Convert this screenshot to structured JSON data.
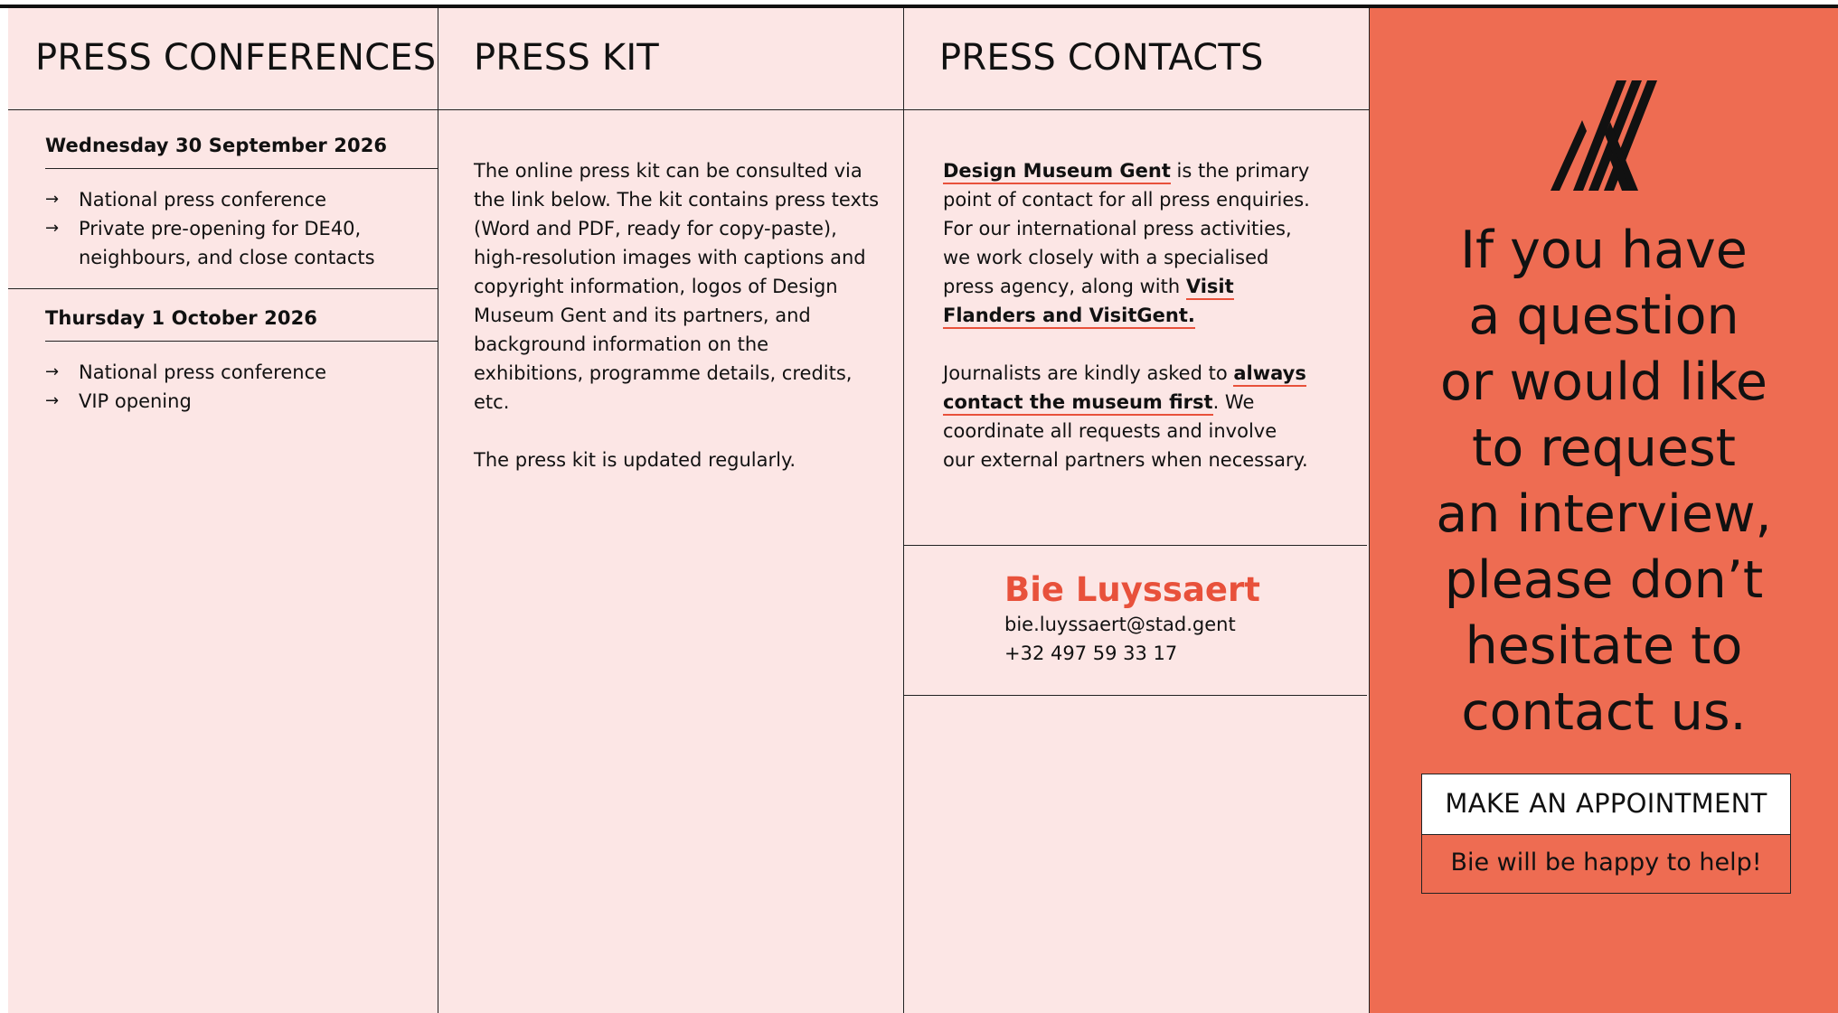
{
  "press_conferences": {
    "title": "PRESS CONFERENCES",
    "days": [
      {
        "date": "Wednesday 30 September 2026",
        "events": [
          "National press conference",
          "Private pre-opening for DE40, neighbours, and close contacts"
        ]
      },
      {
        "date": "Thursday 1 October 2026",
        "events": [
          "National press conference",
          "VIP opening"
        ]
      }
    ]
  },
  "press_kit": {
    "title": "PRESS KIT",
    "paragraph1": "The online press kit can be consulted via the link below. The kit contains press texts (Word and PDF, ready for copy-paste), high-resolution images with captions and copyright information, logos of Design Museum Gent and its partners, and background information on the exhibitions, programme details, credits, etc.",
    "paragraph2": "The press kit is updated regularly."
  },
  "press_contacts": {
    "title": "PRESS CONTACTS",
    "museum_link": "Design Museum Gent",
    "intro_rest": " is the primary point of contact for all press enquiries. For our international press activities, we work closely with a specialised press agency, along with ",
    "agency_link": "Visit Flanders and VisitGent.",
    "ask_text": "Journalists are kindly asked to ",
    "ask_bold": "always contact the museum first",
    "ask_rest": ". We coordinate all requests and involve our external partners when necessary.",
    "contact_name": "Bie Luyssaert",
    "contact_email": "bie.luyssaert@stad.gent",
    "contact_phone": "+32 497 59 33 17"
  },
  "sidebar": {
    "logo_icon": "design-museum-gent-logo-icon",
    "cta_lines": [
      "If you have",
      "a question",
      "or would like",
      "to request",
      "an interview,",
      "please don’t",
      "hesitate to",
      "contact us."
    ],
    "button_label": "MAKE AN APPOINTMENT",
    "help_text": "Bie will be happy to help!"
  },
  "colors": {
    "panel_background": "#fce6e5",
    "accent": "#e8513b",
    "sidebar_background": "#ee6c52"
  }
}
